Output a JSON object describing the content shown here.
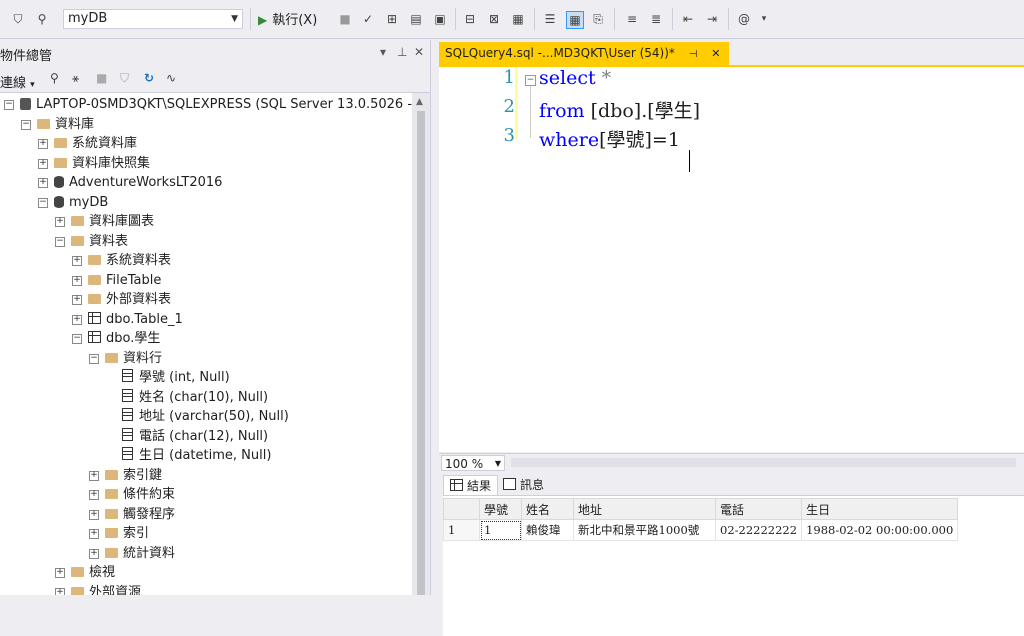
{
  "toolbar": {
    "database": "myDB",
    "execute_label": "執行(X)"
  },
  "object_explorer": {
    "title": "物件總管",
    "connect_label": "連線",
    "tree": [
      {
        "label": "LAPTOP-0SMD3QKT\\SQLEXPRESS (SQL Server 13.0.5026 - LA",
        "kind": "server",
        "level": 0,
        "expanded": true
      },
      {
        "label": "資料庫",
        "kind": "folder",
        "level": 1,
        "expanded": true
      },
      {
        "label": "系統資料庫",
        "kind": "folder",
        "level": 2,
        "expanded": false
      },
      {
        "label": "資料庫快照集",
        "kind": "folder",
        "level": 2,
        "expanded": false
      },
      {
        "label": "AdventureWorksLT2016",
        "kind": "database",
        "level": 2,
        "expanded": false
      },
      {
        "label": "myDB",
        "kind": "database",
        "level": 2,
        "expanded": true
      },
      {
        "label": "資料庫圖表",
        "kind": "folder",
        "level": 3,
        "expanded": false
      },
      {
        "label": "資料表",
        "kind": "folder",
        "level": 3,
        "expanded": true
      },
      {
        "label": "系統資料表",
        "kind": "folder",
        "level": 4,
        "expanded": false
      },
      {
        "label": "FileTable",
        "kind": "folder",
        "level": 4,
        "expanded": false
      },
      {
        "label": "外部資料表",
        "kind": "folder",
        "level": 4,
        "expanded": false
      },
      {
        "label": "dbo.Table_1",
        "kind": "table",
        "level": 4,
        "expanded": false
      },
      {
        "label": "dbo.學生",
        "kind": "table",
        "level": 4,
        "expanded": true
      },
      {
        "label": "資料行",
        "kind": "folder",
        "level": 5,
        "expanded": true
      },
      {
        "label": "學號 (int, Null)",
        "kind": "column",
        "level": 6,
        "expanded": null
      },
      {
        "label": "姓名 (char(10), Null)",
        "kind": "column",
        "level": 6,
        "expanded": null
      },
      {
        "label": "地址 (varchar(50), Null)",
        "kind": "column",
        "level": 6,
        "expanded": null
      },
      {
        "label": "電話 (char(12), Null)",
        "kind": "column",
        "level": 6,
        "expanded": null
      },
      {
        "label": "生日 (datetime, Null)",
        "kind": "column",
        "level": 6,
        "expanded": null
      },
      {
        "label": "索引鍵",
        "kind": "folder",
        "level": 5,
        "expanded": false
      },
      {
        "label": "條件約束",
        "kind": "folder",
        "level": 5,
        "expanded": false
      },
      {
        "label": "觸發程序",
        "kind": "folder",
        "level": 5,
        "expanded": false
      },
      {
        "label": "索引",
        "kind": "folder",
        "level": 5,
        "expanded": false
      },
      {
        "label": "統計資料",
        "kind": "folder",
        "level": 5,
        "expanded": false
      },
      {
        "label": "檢視",
        "kind": "folder",
        "level": 3,
        "expanded": false
      },
      {
        "label": "外部資源",
        "kind": "folder",
        "level": 3,
        "expanded": false
      }
    ]
  },
  "editor": {
    "tab_title": "SQLQuery4.sql -...MD3QKT\\User (54))*",
    "lines": [
      {
        "num": "1",
        "kw": "select",
        "rest": " *"
      },
      {
        "num": "2",
        "kw": "from",
        "rest": " [dbo].[學生]"
      },
      {
        "num": "3",
        "kw": "where",
        "rest": "[學號]=1"
      }
    ],
    "zoom": "100 %"
  },
  "results": {
    "tab_results": "結果",
    "tab_messages": "訊息",
    "columns": [
      "學號",
      "姓名",
      "地址",
      "電話",
      "生日"
    ],
    "rows": [
      {
        "rownum": "1",
        "cells": [
          "1",
          "賴俊瑋",
          "新北中和景平路1000號",
          "02-22222222",
          "1988-02-02 00:00:00.000"
        ]
      }
    ]
  },
  "colors": {
    "accent_tab": "#ffcc00",
    "keyword": "#0000ff",
    "line_number": "#2b91af"
  }
}
